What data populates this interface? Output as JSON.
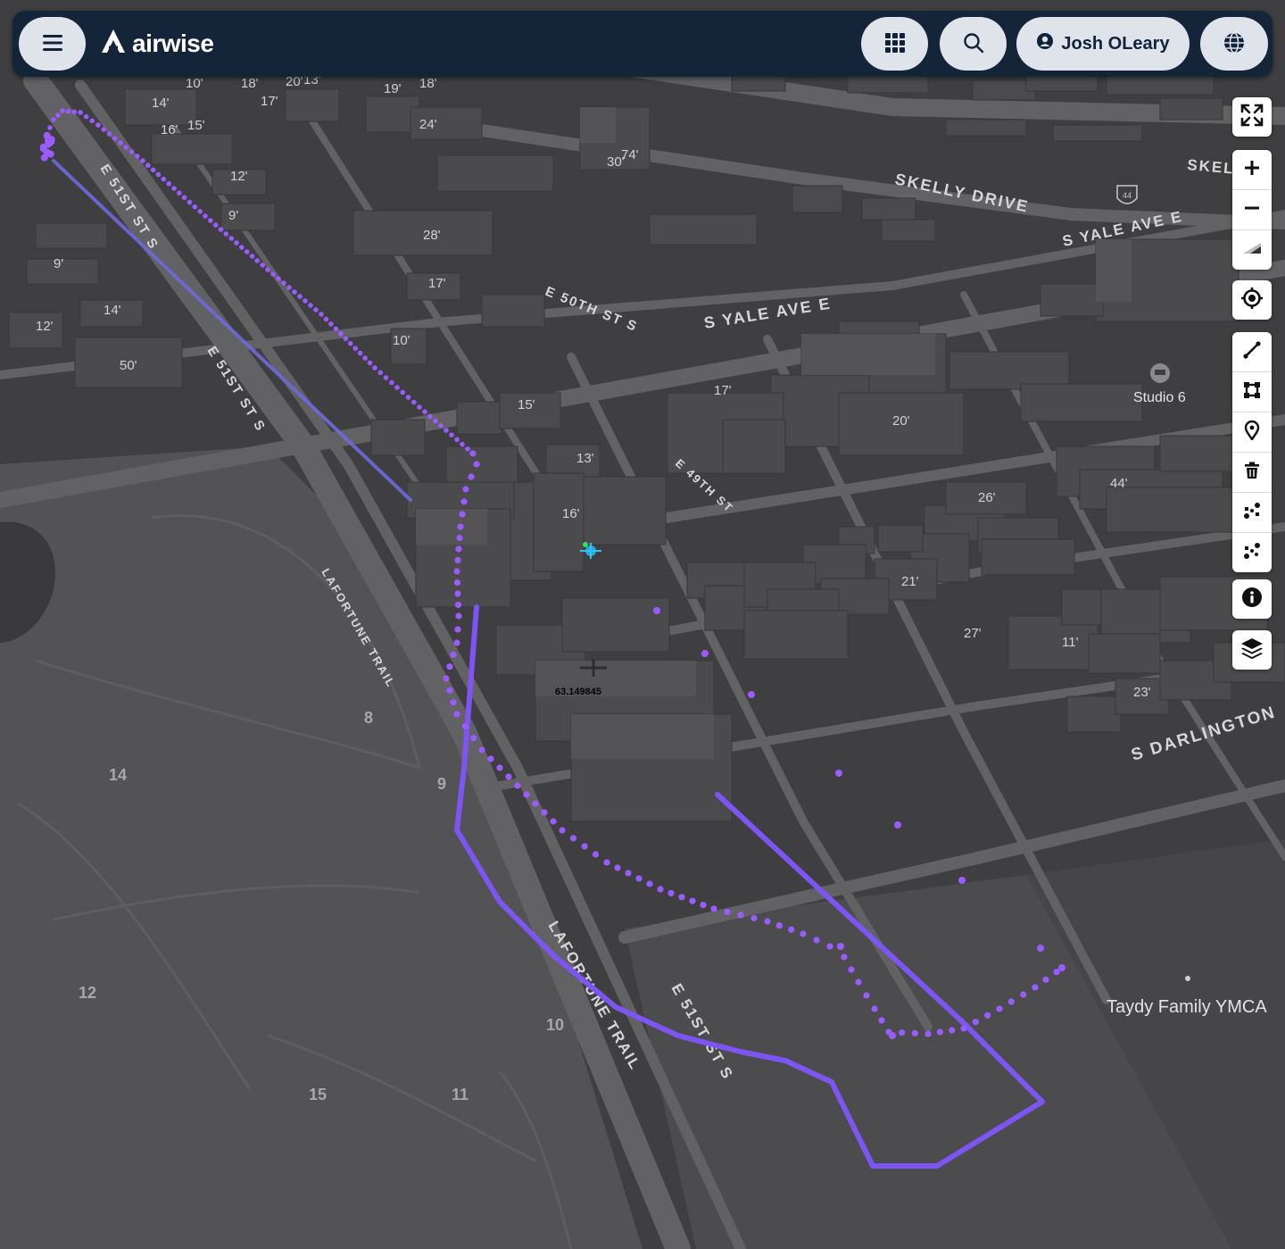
{
  "app": {
    "logo_text": "airwise",
    "user_name": "Josh OLeary"
  },
  "topbar": {
    "menu_icon": "menu-icon",
    "apps_icon": "apps-grid-icon",
    "search_icon": "search-icon",
    "user_icon": "user-icon",
    "globe_icon": "globe-icon"
  },
  "map": {
    "streets": [
      "SKELLY DRIVE",
      "S YALE AVE E",
      "S YALE AVE E",
      "E 50TH ST S",
      "E 51ST ST S",
      "E 51ST ST S",
      "E 49TH ST",
      "LAFORTUNE TRAIL",
      "LAFORTUNE TRAIL",
      "E 51ST ST S",
      "S DARLINGTON",
      "SKEL"
    ],
    "places": [
      "Studio 6",
      "Taydy Family YMCA"
    ],
    "golf_holes": [
      "8",
      "9",
      "14",
      "12",
      "10",
      "15",
      "11"
    ],
    "building_heights": [
      "14'",
      "10'",
      "18'",
      "20'",
      "13'",
      "19'",
      "18'",
      "17'",
      "16'",
      "15'",
      "12'",
      "9'",
      "24'",
      "30'",
      "74'",
      "28'",
      "50'",
      "14'",
      "12'",
      "9'",
      "17'",
      "10'",
      "15'",
      "13'",
      "16'",
      "17'",
      "20'",
      "44'",
      "26'",
      "21'",
      "23'",
      "27'",
      "11'"
    ],
    "drone_label": "63.149845",
    "highway_shield": "44",
    "colors": {
      "flight_path": "#7d55f2",
      "dots": "#9a5cff",
      "ground": "#3f3f41",
      "park": "#505053",
      "road": "#636366",
      "building": "#4a4a4c"
    }
  },
  "controls": {
    "fullscreen": "fullscreen-icon",
    "zoom_in": "zoom-in-icon",
    "zoom_out": "zoom-out-icon",
    "compass": "compass-icon",
    "locate": "locate-icon",
    "draw_line": "draw-line-icon",
    "draw_polygon": "draw-polygon-icon",
    "place_marker": "map-pin-icon",
    "delete": "trash-icon",
    "route_a": "route-icon",
    "route_b": "waypoints-icon",
    "info": "info-icon",
    "layers": "layers-icon"
  }
}
